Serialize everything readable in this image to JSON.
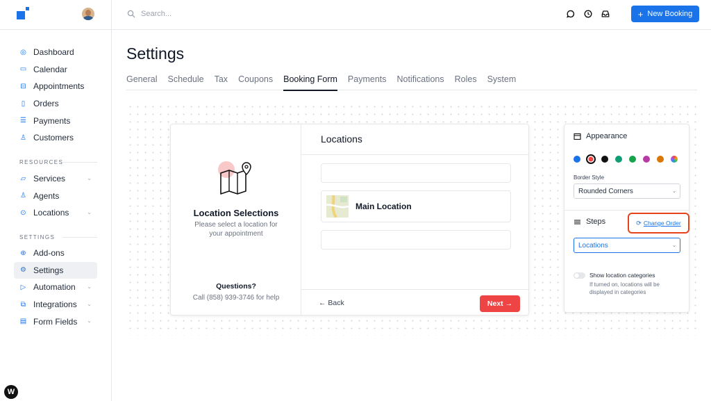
{
  "sidebar": {
    "nav": [
      {
        "label": "Dashboard",
        "icon": "dashboard-icon"
      },
      {
        "label": "Calendar",
        "icon": "calendar-icon"
      },
      {
        "label": "Appointments",
        "icon": "inbox-icon"
      },
      {
        "label": "Orders",
        "icon": "orders-icon"
      },
      {
        "label": "Payments",
        "icon": "payments-icon"
      },
      {
        "label": "Customers",
        "icon": "user-icon"
      }
    ],
    "resources_label": "RESOURCES",
    "resources": [
      {
        "label": "Services",
        "icon": "folder-icon",
        "chevron": true
      },
      {
        "label": "Agents",
        "icon": "user-icon",
        "chevron": false
      },
      {
        "label": "Locations",
        "icon": "location-pin-icon",
        "chevron": true
      }
    ],
    "settings_label": "SETTINGS",
    "settings": [
      {
        "label": "Add-ons",
        "icon": "plus-circle-icon",
        "chevron": false
      },
      {
        "label": "Settings",
        "icon": "gear-icon",
        "chevron": false,
        "active": true
      },
      {
        "label": "Automation",
        "icon": "play-icon",
        "chevron": true
      },
      {
        "label": "Integrations",
        "icon": "integrations-icon",
        "chevron": true
      },
      {
        "label": "Form Fields",
        "icon": "form-icon",
        "chevron": true
      }
    ]
  },
  "header": {
    "search_placeholder": "Search...",
    "new_booking_label": "New Booking",
    "new_booking_plus": "+"
  },
  "page": {
    "title": "Settings",
    "tabs": [
      "General",
      "Schedule",
      "Tax",
      "Coupons",
      "Booking Form",
      "Payments",
      "Notifications",
      "Roles",
      "System"
    ],
    "active_tab": "Booking Form"
  },
  "preview": {
    "left_title": "Location Selections",
    "left_subtitle": "Please select a location for your appointment",
    "questions_title": "Questions?",
    "questions_text": "Call (858) 939-3746 for help",
    "right_title": "Locations",
    "location_item": "Main Location",
    "back_label": "← Back",
    "next_label": "Next →"
  },
  "panel": {
    "appearance_label": "Appearance",
    "swatches": [
      "#1a73e8",
      "#ef4444",
      "#111111",
      "#0f9d76",
      "#16a34a",
      "#b83aa5",
      "#d97706",
      "rainbow"
    ],
    "selected_swatch": 1,
    "border_style_label": "Border Style",
    "border_style_value": "Rounded Corners",
    "steps_label": "Steps",
    "change_order_label": "Change Order",
    "steps_value": "Locations",
    "toggle_label": "Show location categories",
    "toggle_desc": "If turned on, locations will be displayed in categories"
  },
  "colors": {
    "accent": "#1a73e8",
    "next_button": "#ef4444",
    "highlight": "#e8421d"
  }
}
